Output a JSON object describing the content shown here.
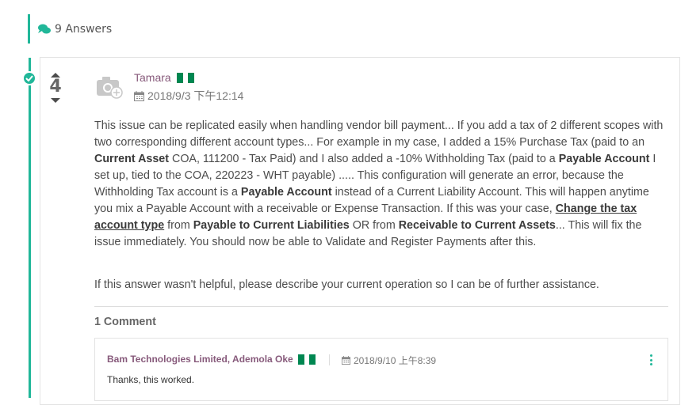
{
  "header": {
    "answers_label": "9 Answers",
    "accent": "#21b799"
  },
  "answer": {
    "votes": "4",
    "accepted": true,
    "author": "Tamara",
    "date": "2018/9/3 下午12:14",
    "body": {
      "p1": "This issue can be replicated easily when handling vendor bill payment... If you add a tax of 2 different scopes with two corresponding different account types... For example in my case, I added a 15% Purchase Tax (paid to an ",
      "p1_b1": "Current Asset",
      "p2": " COA,  111200 - Tax Paid)  and I also added a -10% Withholding Tax (paid to a ",
      "p2_b2": "Payable Account",
      "p3": " I set up, tied to the COA, 220223 - WHT payable) ..... This configuration will generate an error, because the Withholding Tax account is a ",
      "p3_b3": "Payable Account",
      "p4": " instead of a Current Liability Account. This will happen anytime you mix a Payable Account with a receivable or Expense Transaction. If this was your case, ",
      "p4_link": "Change the tax account type",
      "p5": " from ",
      "p5_b4": "Payable to Current Liabilities",
      "p6": " OR from ",
      "p6_b5": "Receivable to Current Assets",
      "p7": "... This will fix the issue immediately. You should now be able to Validate and Register Payments after this."
    },
    "followup": "If this answer wasn't helpful, please describe your current operation so I can be of further assistance."
  },
  "comments": {
    "title": "1 Comment",
    "items": [
      {
        "author": "Bam Technologies Limited, Ademola Oke",
        "date": "2018/9/10 上午8:39",
        "text": "Thanks, this worked."
      }
    ]
  },
  "icons": [
    "chat-icon",
    "check-icon",
    "camera-icon",
    "calendar-icon",
    "flag-nigeria-icon",
    "more-menu-icon"
  ],
  "colors": {
    "accent": "#21b799",
    "author": "#875a7b",
    "flag_green": "#008751"
  }
}
